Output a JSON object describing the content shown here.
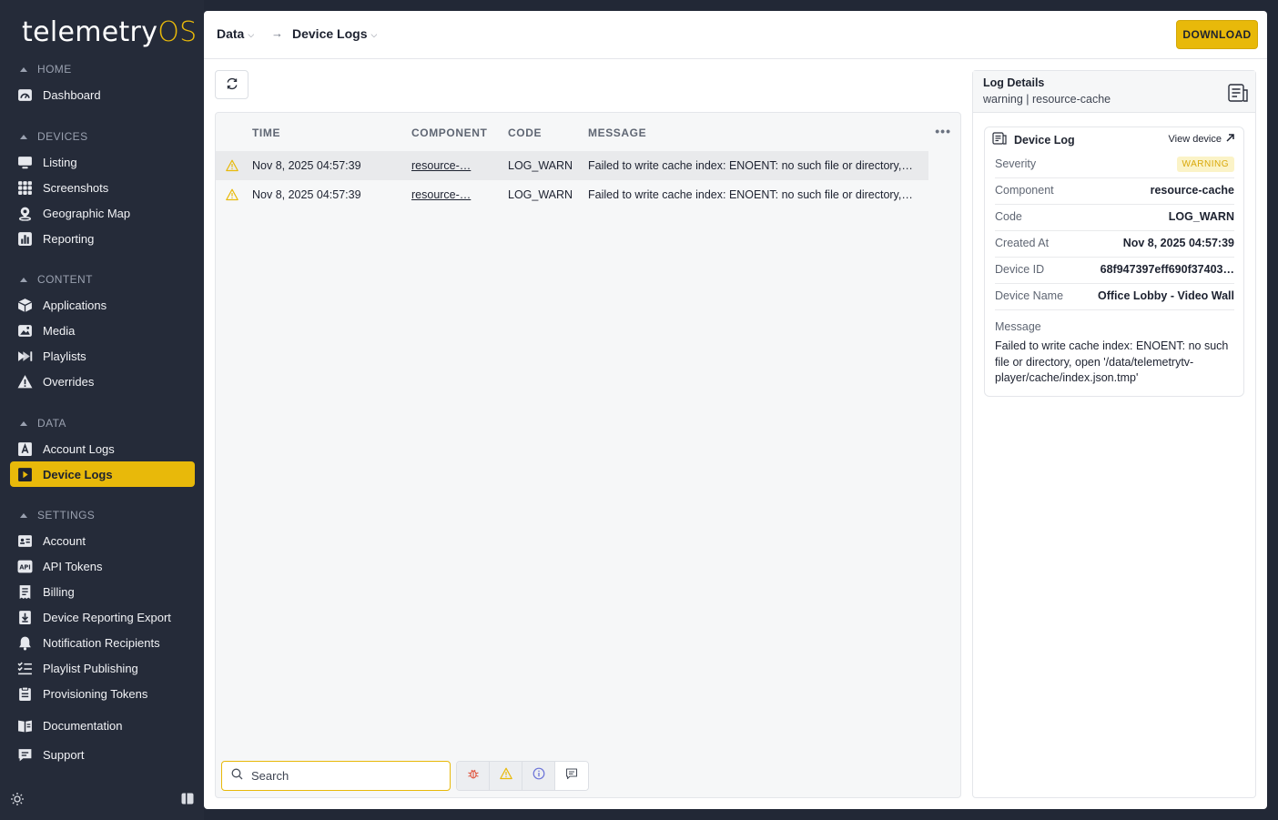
{
  "app": {
    "logo_main": "telemetry",
    "logo_accent": "OS"
  },
  "sidebar": {
    "sections": [
      {
        "title": "HOME",
        "items": [
          {
            "label": "Dashboard",
            "icon": "dashboard-icon"
          }
        ]
      },
      {
        "title": "DEVICES",
        "items": [
          {
            "label": "Listing",
            "icon": "monitor-icon"
          },
          {
            "label": "Screenshots",
            "icon": "grid-icon"
          },
          {
            "label": "Geographic Map",
            "icon": "map-pin-icon"
          },
          {
            "label": "Reporting",
            "icon": "bar-chart-icon"
          }
        ]
      },
      {
        "title": "CONTENT",
        "items": [
          {
            "label": "Applications",
            "icon": "cube-icon"
          },
          {
            "label": "Media",
            "icon": "image-icon"
          },
          {
            "label": "Playlists",
            "icon": "playlist-icon"
          },
          {
            "label": "Overrides",
            "icon": "alert-triangle-icon"
          }
        ]
      },
      {
        "title": "DATA",
        "items": [
          {
            "label": "Account Logs",
            "icon": "account-log-icon"
          },
          {
            "label": "Device Logs",
            "icon": "device-log-icon",
            "active": true
          }
        ]
      },
      {
        "title": "SETTINGS",
        "items": [
          {
            "label": "Account",
            "icon": "id-card-icon"
          },
          {
            "label": "API Tokens",
            "icon": "api-icon"
          },
          {
            "label": "Billing",
            "icon": "receipt-icon"
          },
          {
            "label": "Device Reporting Export",
            "icon": "download-doc-icon"
          },
          {
            "label": "Notification Recipients",
            "icon": "bell-icon"
          },
          {
            "label": "Playlist Publishing",
            "icon": "checklist-icon"
          },
          {
            "label": "Provisioning Tokens",
            "icon": "clipboard-icon"
          }
        ]
      }
    ],
    "extra": [
      {
        "label": "Documentation",
        "icon": "book-icon"
      },
      {
        "label": "Support",
        "icon": "chat-icon"
      }
    ]
  },
  "header": {
    "crumb1": "Data",
    "crumb2": "Device Logs",
    "download_label": "DOWNLOAD"
  },
  "table": {
    "columns": {
      "time": "TIME",
      "component": "COMPONENT",
      "code": "CODE",
      "message": "MESSAGE"
    },
    "rows": [
      {
        "time": "Nov 8, 2025 04:57:39",
        "component": "resource-…",
        "code": "LOG_WARN",
        "message": "Failed to write cache index: ENOENT: no such file or directory,…"
      },
      {
        "time": "Nov 8, 2025 04:57:39",
        "component": "resource-…",
        "code": "LOG_WARN",
        "message": "Failed to write cache index: ENOENT: no such file or directory,…"
      }
    ],
    "search_placeholder": "Search"
  },
  "details": {
    "title": "Log Details",
    "subtitle": "warning | resource-cache",
    "card_title": "Device Log",
    "view_device": "View device",
    "fields": {
      "severity_label": "Severity",
      "severity_value": "WARNING",
      "component_label": "Component",
      "component_value": "resource-cache",
      "code_label": "Code",
      "code_value": "LOG_WARN",
      "created_label": "Created At",
      "created_value": "Nov 8, 2025 04:57:39",
      "device_id_label": "Device ID",
      "device_id_value": "68f947397eff690f37403…",
      "device_name_label": "Device Name",
      "device_name_value": "Office Lobby - Video Wall"
    },
    "message_label": "Message",
    "message_value": "Failed to write cache index: ENOENT: no such file or directory, open '/data/telemetrytv-player/cache/index.json.tmp'"
  },
  "colors": {
    "accent": "#e8b90a",
    "sidebar_bg": "#252b39",
    "warning": "#e8b90a",
    "error": "#e0533c",
    "info": "#6b73d8"
  }
}
